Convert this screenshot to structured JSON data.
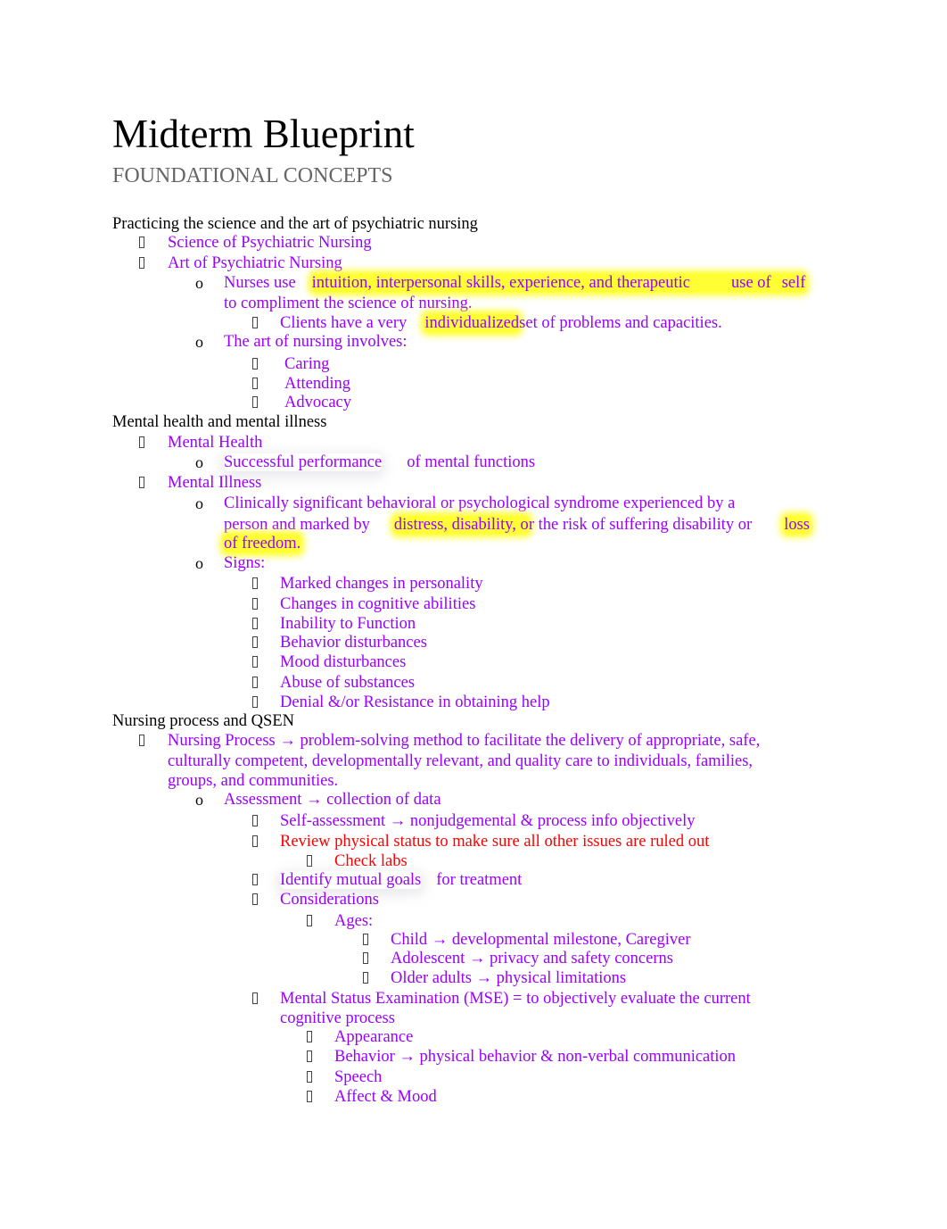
{
  "document": {
    "title": "Midterm Blueprint",
    "subtitle": "FOUNDATIONAL CONCEPTS",
    "colors": {
      "heading_text": "#000000",
      "subtitle_text": "#666666",
      "note_text": "#9900ff",
      "emphasis_text": "#ff0000",
      "highlight": "#ffff33"
    },
    "bullet_icons": {
      "level1": "missing-glyph-box",
      "level2": "o",
      "level3": "missing-glyph-box"
    }
  },
  "sections": [
    {
      "heading": "Practicing the science and the art of psychiatric nursing",
      "items": {
        "science": "Science of Psychiatric Nursing",
        "art": "Art of Psychiatric Nursing",
        "nurses_use_prefix": "Nurses use",
        "nurses_use_highlight": "intuition, interpersonal skills, experience, and therapeutic",
        "nurses_use_hl2a": "use of",
        "nurses_use_hl2b": "self",
        "nurses_use_cont": "to compliment the science of nursing.",
        "clients_prefix": "Clients have a very",
        "clients_highlight": "individualized",
        "clients_suffix": "set of problems and capacities.",
        "art_involves": "The art of nursing involves:",
        "involves_list": [
          "Caring",
          "Attending",
          "Advocacy"
        ]
      }
    },
    {
      "heading": "Mental health and mental illness",
      "items": {
        "mental_health": "Mental Health",
        "successful_prefix": "Successful performance",
        "successful_suffix": "of mental functions",
        "mental_illness": "Mental Illness",
        "clinically_line1": "Clinically significant behavioral or psychological syndrome experienced by a",
        "clinically_l2_prefix": "person and marked by",
        "clinically_l2_highlight": "distress, disability, o",
        "clinically_l2_mid": "r the risk of suffering disability or",
        "clinically_l2_hl2": "loss",
        "clinically_l3_highlight": "of freedom.",
        "signs_label": "Signs:",
        "signs": [
          "Marked changes in personality",
          "Changes in cognitive abilities",
          "Inability to Function",
          "Behavior disturbances",
          "Mood disturbances",
          "Abuse of substances",
          "Denial &/or Resistance in obtaining help"
        ]
      }
    },
    {
      "heading": "Nursing process and QSEN",
      "items": {
        "nursing_process_l1": "Nursing Process → problem-solving method to facilitate the delivery of appropriate, safe,",
        "nursing_process_l2": "culturally competent, developmentally relevant, and quality care to individuals, families,",
        "nursing_process_l3": "groups, and communities.",
        "assessment": "Assessment → collection of data",
        "self_assessment": "Self-assessment → nonjudgemental & process info objectively",
        "review_physical": "Review physical status to make sure all other issues are ruled out",
        "check_labs": "Check labs",
        "identify_goals_prefix": "Identify mutual goals",
        "identify_goals_suffix": "for treatment",
        "considerations": "Considerations",
        "ages_label": "Ages:",
        "ages": [
          "Child → developmental milestone, Caregiver",
          "Adolescent → privacy and safety concerns",
          "Older adults → physical limitations"
        ],
        "mse_l1": "Mental Status Examination (MSE) = to objectively evaluate the current",
        "mse_l2": "cognitive process",
        "mse_items": [
          "Appearance",
          "Behavior → physical behavior & non-verbal communication",
          "Speech",
          "Affect & Mood"
        ]
      }
    }
  ]
}
